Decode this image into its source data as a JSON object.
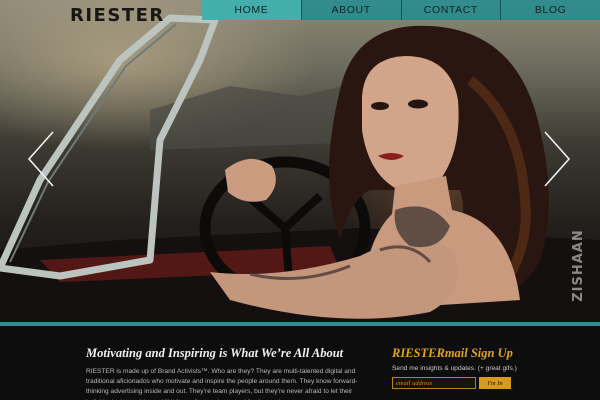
{
  "brand": {
    "logo": "RIESTER"
  },
  "nav": {
    "items": [
      "HOME",
      "ABOUT",
      "CONTACT",
      "BLOG"
    ],
    "active": "HOME"
  },
  "watermark": "ZISHAAN",
  "about": {
    "title": "Motivating and Inspiring is What We’re All About",
    "body": "RIESTER is made up of Brand Activists™. Who are they? They are multi-talented digital and traditional aficionados who motivate and inspire the people around them. They know forward-thinking advertising inside and out. They’re team players, but they’re never afraid to let their individual talents shine to kill it for a client project—and for themselves."
  },
  "signup": {
    "title_brand": "RIESTER",
    "title_rest": "mail Sign Up",
    "text": "Send me insights & updates. (+ great gifs.)",
    "email_placeholder": "email address",
    "submit_label": "I'm In"
  },
  "colors": {
    "nav": "#268c8e",
    "nav_active": "#46b4b2",
    "strip": "#2c8f92",
    "accent": "#e2a21e",
    "footer_bg": "#0d0d0d"
  },
  "icons": {
    "prev": "chevron-left-icon",
    "next": "chevron-right-icon"
  }
}
